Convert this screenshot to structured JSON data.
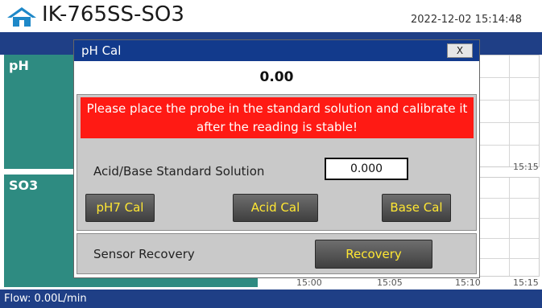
{
  "header": {
    "home_icon": "home-icon",
    "device_name": "IK-765SS-SO3",
    "datetime": "2022-12-02 15:14:48"
  },
  "panels": {
    "ph_label": "pH",
    "so3_label": "SO3"
  },
  "chart": {
    "top_right_time": "15:15",
    "bottom_times": [
      "15:00",
      "15:05",
      "15:10",
      "15:15"
    ]
  },
  "footer": {
    "flow_text": "Flow:  0.00L/min"
  },
  "dialog": {
    "title": "pH Cal",
    "close_label": "X",
    "reading": "0.00",
    "warning": "Please place the probe in the standard solution and calibrate it after the reading is stable!",
    "standard_solution_label": "Acid/Base Standard Solution",
    "standard_solution_value": "0.000",
    "buttons": {
      "ph7": "pH7 Cal",
      "acid": "Acid Cal",
      "base": "Base Cal"
    },
    "recovery_label": "Sensor Recovery",
    "recovery_button": "Recovery"
  },
  "colors": {
    "nav_blue": "#1f3f86",
    "teal": "#2e8b81",
    "warning_red": "#ff1a14",
    "button_text_yellow": "#ffe733"
  }
}
